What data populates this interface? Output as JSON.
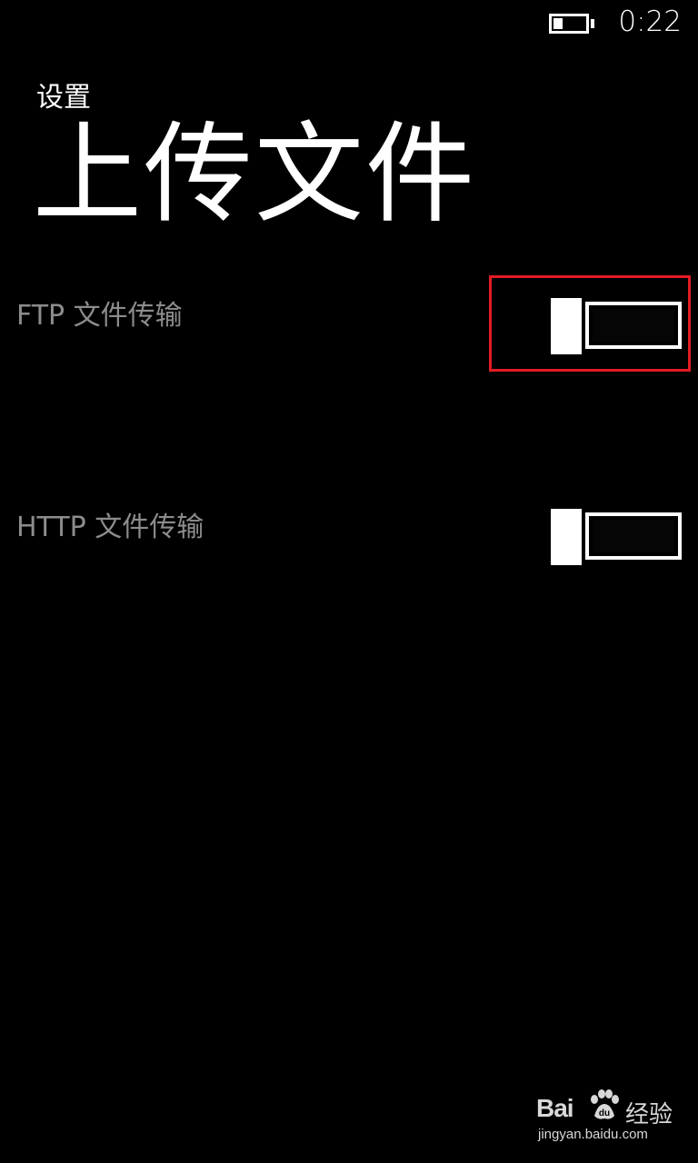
{
  "status_bar": {
    "time": "0:22",
    "battery_icon": "battery-low-icon",
    "battery_level": 0.3
  },
  "header": {
    "app_title": "设置",
    "page_title": "上传文件"
  },
  "settings": [
    {
      "label": "FTP 文件传输",
      "state": "off"
    },
    {
      "label": "HTTP 文件传输",
      "state": "off"
    }
  ],
  "annotation": {
    "highlight_color": "#e21b23"
  },
  "watermark": {
    "brand": "Bai",
    "paw_icon": "baidu-paw-icon",
    "suffix": "经验",
    "url": "jingyan.baidu.com"
  },
  "colors": {
    "background": "#000000",
    "foreground": "#ffffff",
    "label": "#8c8c8c"
  }
}
